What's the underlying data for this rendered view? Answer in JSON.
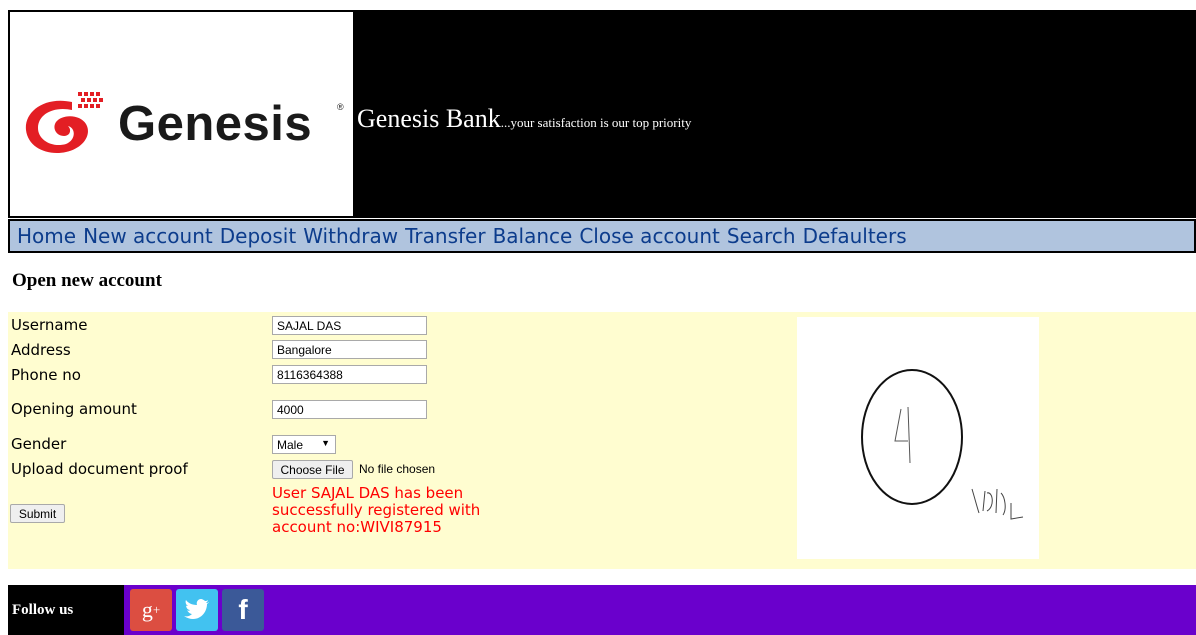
{
  "header": {
    "logo_text": "Genesis",
    "logo_mark": "®",
    "bank_name": "Genesis Bank",
    "tagline": "...your satisfaction is our top priority"
  },
  "nav": {
    "items": [
      "Home",
      "New account",
      "Deposit",
      "Withdraw",
      "Transfer",
      "Balance",
      "Close account",
      "Search",
      "Defaulters"
    ]
  },
  "page": {
    "title": "Open new account"
  },
  "form": {
    "username_label": "Username",
    "username_value": "SAJAL DAS",
    "address_label": "Address",
    "address_value": "Bangalore",
    "phone_label": "Phone no",
    "phone_value": "8116364388",
    "amount_label": "Opening amount",
    "amount_value": "4000",
    "gender_label": "Gender",
    "gender_value": "Male",
    "upload_label": "Upload document proof",
    "file_button": "Choose File",
    "file_status": "No file chosen",
    "submit_label": "Submit",
    "success_message": "User SAJAL DAS has been successfully registered with account no:WIVI87915"
  },
  "footer": {
    "follow_label": "Follow us",
    "social": [
      "google-plus-icon",
      "twitter-icon",
      "facebook-icon"
    ]
  },
  "colors": {
    "header_bg": "#000000",
    "nav_bg": "#b0c4de",
    "nav_text": "#0c3c8c",
    "form_bg": "#fffdd0",
    "success_text": "#ff0000",
    "footer_bg": "#6a00cc"
  }
}
